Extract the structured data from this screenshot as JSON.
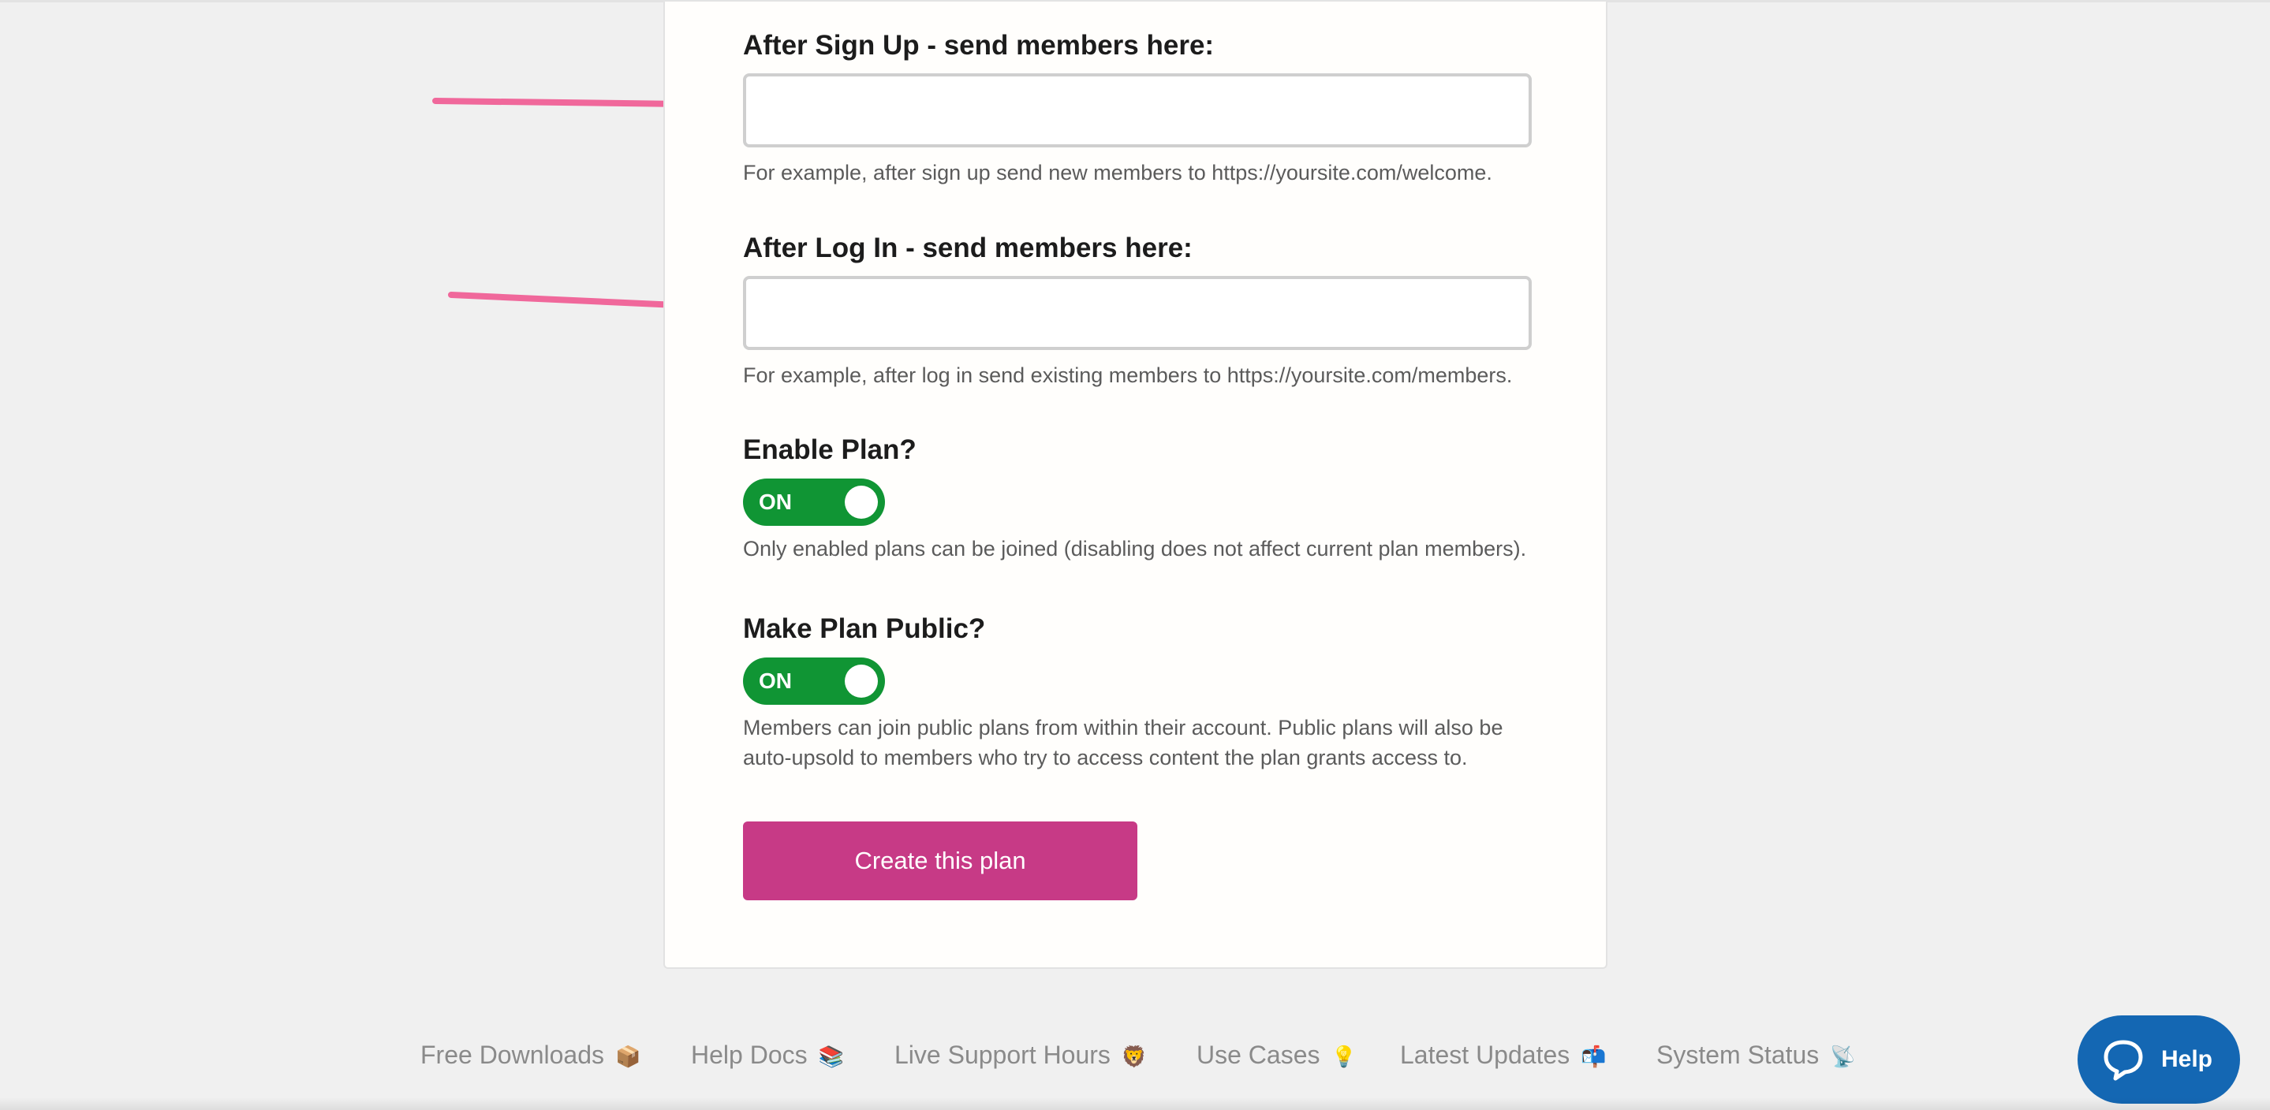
{
  "form": {
    "signup_redirect": {
      "label": "After Sign Up - send members here:",
      "value": "",
      "help": "For example, after sign up send new members to https://yoursite.com/welcome."
    },
    "login_redirect": {
      "label": "After Log In - send members here:",
      "value": "",
      "help": "For example, after log in send existing members to https://yoursite.com/members."
    },
    "enable_plan": {
      "label": "Enable Plan?",
      "state": "ON",
      "help": "Only enabled plans can be joined (disabling does not affect current plan members)."
    },
    "make_public": {
      "label": "Make Plan Public?",
      "state": "ON",
      "help_line1": "Members can join public plans from within their account. Public plans will also be",
      "help_line2": "auto-upsold to members who try to access content the plan grants access to."
    },
    "create_button": "Create this plan"
  },
  "footer": {
    "links": [
      {
        "label": "Free Downloads",
        "emoji": "📦"
      },
      {
        "label": "Help Docs",
        "emoji": "📚"
      },
      {
        "label": "Live Support Hours",
        "emoji": "🦁"
      },
      {
        "label": "Use Cases",
        "emoji": "💡"
      },
      {
        "label": "Latest Updates",
        "emoji": "📬"
      },
      {
        "label": "System Status",
        "emoji": "📡"
      }
    ]
  },
  "help_widget": {
    "label": "Help",
    "icon": "chat-bubble-icon"
  },
  "colors": {
    "toggle_on": "#109534",
    "primary_button": "#c73a86",
    "annotation_arrow": "#f0689b",
    "help_widget": "#1467b3"
  }
}
